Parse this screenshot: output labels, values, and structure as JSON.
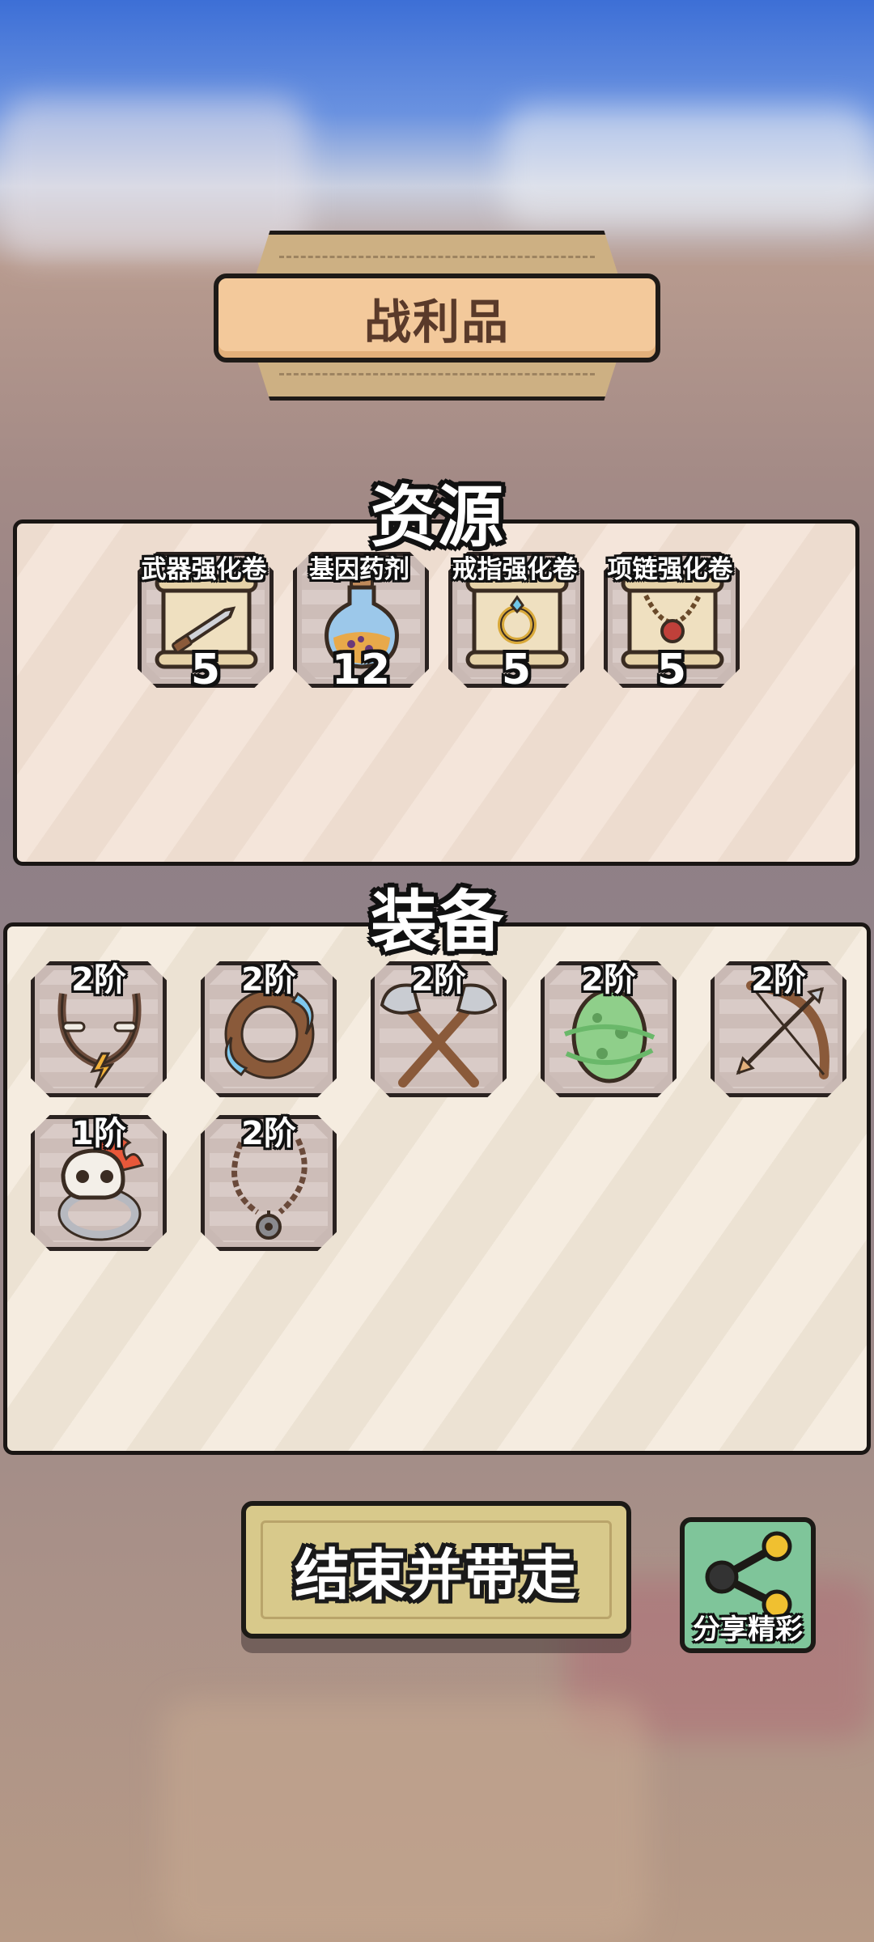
{
  "title_banner": {
    "title": "战利品"
  },
  "resources": {
    "heading": "资源",
    "items": [
      {
        "label": "武器强化卷",
        "qty": "5",
        "icon": "weapon-scroll-icon"
      },
      {
        "label": "基因药剂",
        "qty": "12",
        "icon": "gene-potion-icon"
      },
      {
        "label": "戒指强化卷",
        "qty": "5",
        "icon": "ring-scroll-icon"
      },
      {
        "label": "项链强化卷",
        "qty": "5",
        "icon": "necklace-scroll-icon"
      }
    ]
  },
  "equipment": {
    "heading": "装备",
    "items": [
      {
        "tier": "2阶",
        "icon": "bone-necklace-icon"
      },
      {
        "tier": "2阶",
        "icon": "water-ring-icon"
      },
      {
        "tier": "2阶",
        "icon": "crossed-axes-icon"
      },
      {
        "tier": "2阶",
        "icon": "green-egg-icon"
      },
      {
        "tier": "2阶",
        "icon": "bow-arrow-icon"
      },
      {
        "tier": "1阶",
        "icon": "skull-ring-icon"
      },
      {
        "tier": "2阶",
        "icon": "rope-necklace-icon"
      }
    ]
  },
  "actions": {
    "end_label": "结束并带走",
    "share_label": "分享精彩"
  }
}
